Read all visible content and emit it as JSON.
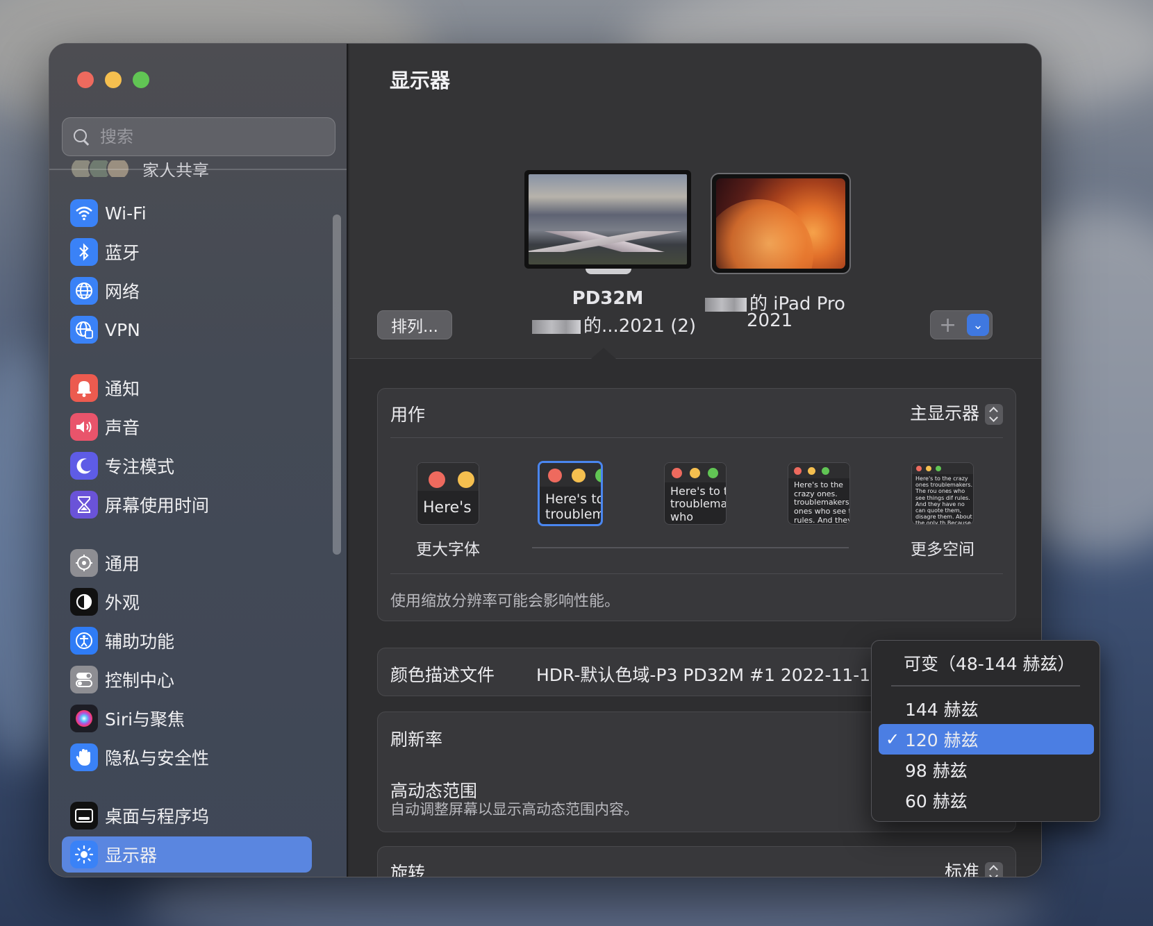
{
  "window": {
    "title": "显示器"
  },
  "sidebar": {
    "search_placeholder": "搜索",
    "family_label": "家人共享",
    "items": [
      {
        "label": "Wi-Fi",
        "icon": "wifi-icon",
        "color": "#3a82f7"
      },
      {
        "label": "蓝牙",
        "icon": "bluetooth-icon",
        "color": "#3a82f7"
      },
      {
        "label": "网络",
        "icon": "globe-icon",
        "color": "#3a82f7"
      },
      {
        "label": "VPN",
        "icon": "vpn-globe-icon",
        "color": "#3a82f7"
      },
      {
        "label": "通知",
        "icon": "bell-icon",
        "color": "#ec5b4f"
      },
      {
        "label": "声音",
        "icon": "speaker-icon",
        "color": "#e9546b"
      },
      {
        "label": "专注模式",
        "icon": "moon-icon",
        "color": "#5e5ce6"
      },
      {
        "label": "屏幕使用时间",
        "icon": "hourglass-icon",
        "color": "#6a53d8"
      },
      {
        "label": "通用",
        "icon": "gear-icon",
        "color": "#8e8e93"
      },
      {
        "label": "外观",
        "icon": "appearance-icon",
        "color": "#111111"
      },
      {
        "label": "辅助功能",
        "icon": "accessibility-icon",
        "color": "#2f7cf6"
      },
      {
        "label": "控制中心",
        "icon": "toggles-icon",
        "color": "#8e8e93"
      },
      {
        "label": "Siri与聚焦",
        "icon": "siri-icon",
        "color": "#1d1d25"
      },
      {
        "label": "隐私与安全性",
        "icon": "hand-icon",
        "color": "#3a82f7"
      },
      {
        "label": "桌面与程序坞",
        "icon": "dock-icon",
        "color": "#111111"
      },
      {
        "label": "显示器",
        "icon": "sun-icon",
        "color": "#3a82f7",
        "active": true
      }
    ]
  },
  "main": {
    "arrange_button": "排列...",
    "displays": [
      {
        "name": "PD32M",
        "subtitle": "的...2021 (2)"
      },
      {
        "name": "的 iPad Pro",
        "subtitle": "2021"
      }
    ],
    "add_plus": "+",
    "add_chevron": "⌄",
    "use_as": {
      "label": "用作",
      "value": "主显示器"
    },
    "resolution_options": [
      {
        "label": "更大字体",
        "sample": "Here's"
      },
      {
        "label": "",
        "sample": "Here's to the troublem"
      },
      {
        "label": "",
        "sample": "Here's to the troublema ones who"
      },
      {
        "label": "",
        "sample": "Here's to the crazy ones. troublemakers. ones who see t rules. And they"
      },
      {
        "label": "更多空间",
        "sample": "Here's to the crazy ones troublemakers. The rou ones who see things dif rules. And they have no can quote them, disagre them. About the only th Because they change th"
      }
    ],
    "scaling_note": "使用缩放分辨率可能会影响性能。",
    "color_profile": {
      "label": "颜色描述文件",
      "value": "HDR-默认色域-P3 PD32M #1 2022-11-1"
    },
    "refresh_rate": {
      "label": "刷新率"
    },
    "hdr": {
      "label": "高动态范围",
      "sub": "自动调整屏幕以显示高动态范围内容。"
    },
    "rotation": {
      "label": "旋转",
      "value": "标准"
    }
  },
  "dropdown": {
    "header": "可变（48-144 赫兹）",
    "options": [
      "144 赫兹",
      "120 赫兹",
      "98 赫兹",
      "60 赫兹"
    ],
    "selected": "120 赫兹",
    "check": "✓"
  }
}
